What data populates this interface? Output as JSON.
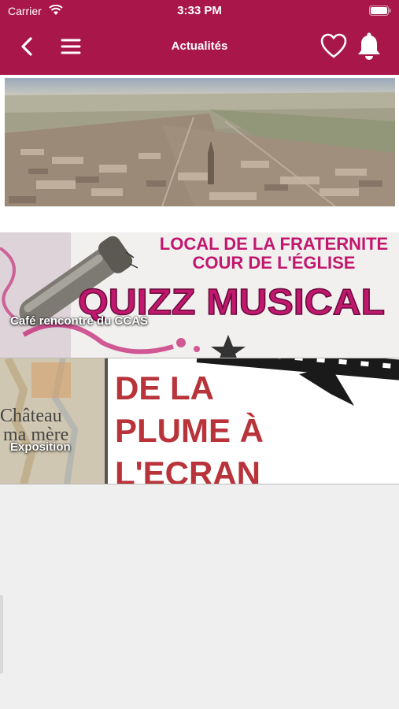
{
  "status_bar": {
    "carrier": "Carrier",
    "time": "3:33 PM"
  },
  "nav": {
    "title": "Actualités",
    "back_icon": "chevron-left-icon",
    "menu_icon": "hamburger-menu-icon",
    "favorite_icon": "heart-icon",
    "notification_icon": "bell-icon"
  },
  "colors": {
    "brand": "#a8164a",
    "background": "#efefef",
    "pink_text": "#c2176e",
    "red_title": "#b8333a"
  },
  "feed": {
    "cards": [
      {
        "label": "",
        "image": "aerial view of town"
      },
      {
        "label": "Café rencontre du CCAS",
        "poster_lines": [
          "LOCAL DE LA FRATERNITE",
          "COUR DE L'ÉGLISE",
          "QUIZZ MUSICAL"
        ]
      },
      {
        "label": "Exposition",
        "poster_lines": [
          "DE LA",
          "PLUME À",
          "L'ECRAN"
        ],
        "book_title": [
          "Château",
          "ma mère"
        ]
      }
    ]
  }
}
